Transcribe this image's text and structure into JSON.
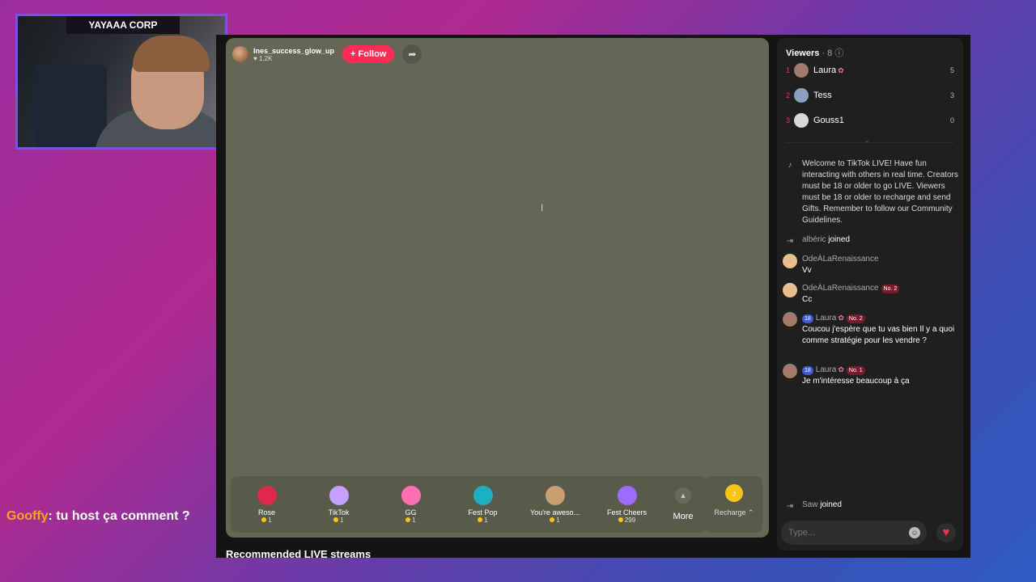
{
  "overlay": {
    "webcam_title": "YAYAAA CORP",
    "stream_chat": {
      "user": "Gooffy",
      "message": ": tu host ça comment ?"
    }
  },
  "live": {
    "host": {
      "name": "Ines_success_glow_up",
      "likes": "♥ 1.2K"
    },
    "follow_label": "+ Follow",
    "gifts": [
      {
        "name": "Rose",
        "price": "1",
        "color": "#e0284d"
      },
      {
        "name": "TikTok",
        "price": "1",
        "color": "#c6a0ff"
      },
      {
        "name": "GG",
        "price": "1",
        "color": "#ff6fb0"
      },
      {
        "name": "Fest Pop",
        "price": "1",
        "color": "#1bb0c4"
      },
      {
        "name": "You're aweso...",
        "price": "1",
        "color": "#c8a070"
      },
      {
        "name": "Fest Cheers",
        "price": "299",
        "color": "#9b6cff"
      }
    ],
    "more_label": "More",
    "recharge_label": "Recharge ⌃",
    "recommended_title": "Recommended LIVE streams"
  },
  "panel": {
    "viewers_label": "Viewers",
    "viewers_count": "· 8",
    "viewers": [
      {
        "rank": "1",
        "name": "Laura",
        "score": "5",
        "color": "#a07a6a"
      },
      {
        "rank": "2",
        "name": "Tess",
        "score": "3",
        "color": "#8aa0c0"
      },
      {
        "rank": "3",
        "name": "Gouss1",
        "score": "0",
        "color": "#d8d8d8"
      }
    ],
    "welcome": "Welcome to TikTok LIVE! Have fun interacting with others in real time. Creators must be 18 or older to go LIVE. Viewers must be 18 or older to recharge and send Gifts. Remember to follow our Community Guidelines.",
    "messages": [
      {
        "user": "albéric",
        "text": "joined"
      },
      {
        "user": "OdeÀLaRenaissance",
        "text": "Vv"
      },
      {
        "user": "OdeÀLaRenaissance",
        "badge_no": "No. 2",
        "text": "Cc"
      },
      {
        "user": "Laura",
        "level": "18",
        "badge_no": "No. 2",
        "text": "Coucou j'espère que tu vas bien Il y a quoi comme stratégie pour les vendre ?"
      },
      {
        "user": "Laura",
        "level": "18",
        "badge_no": "No. 1",
        "text": "Je m'intéresse beaucoup à ça"
      },
      {
        "user": "Saw",
        "text": "joined"
      }
    ],
    "input_placeholder": "Type..."
  }
}
